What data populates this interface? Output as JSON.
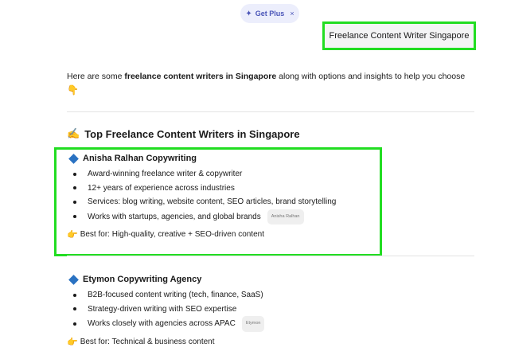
{
  "banner": {
    "label": "Get Plus",
    "close": "×"
  },
  "user_message": "Freelance Content Writer Singapore",
  "response": {
    "intro_pre": "Here are some ",
    "intro_bold": "freelance content writers in Singapore",
    "intro_post": " along with options and insights to help you choose",
    "intro_emoji": "👇",
    "section_emoji": "✍️",
    "section_title": "Top Freelance Content Writers in Singapore",
    "writers": [
      {
        "name": "Anisha Ralhan Copywriting",
        "bullets": [
          "Award-winning freelance writer & copywriter",
          "12+ years of experience across industries",
          "Services: blog writing, website content, SEO articles, brand storytelling",
          "Works with startups, agencies, and global brands"
        ],
        "source_chip": "Anisha Ralhan",
        "best_for": "Best for: High-quality, creative + SEO-driven content"
      },
      {
        "name": "Etymon Copywriting Agency",
        "bullets": [
          "B2B-focused content writing (tech, finance, SaaS)",
          "Strategy-driven writing with SEO expertise",
          "Works closely with agencies across APAC"
        ],
        "source_chip": "Etymon",
        "best_for": "Best for: Technical & business content"
      }
    ]
  },
  "colors": {
    "highlight": "#22dd22",
    "diamond": "#2a72c2",
    "plus_accent": "#4a55b8"
  }
}
